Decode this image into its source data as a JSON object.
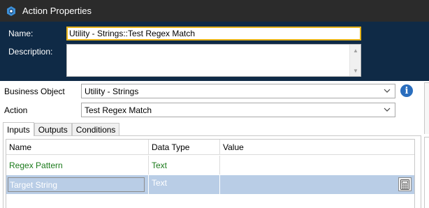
{
  "window": {
    "title": "Action Properties",
    "app_icon": "blueprism-process-icon"
  },
  "header": {
    "name_label": "Name:",
    "name_value": "Utility - Strings::Test Regex Match",
    "description_label": "Description:",
    "description_value": ""
  },
  "form": {
    "business_object_label": "Business Object",
    "business_object_value": "Utility - Strings",
    "action_label": "Action",
    "action_value": "Test Regex Match",
    "info_icon": "info-icon"
  },
  "tabs": [
    {
      "label": "Inputs",
      "active": true
    },
    {
      "label": "Outputs",
      "active": false
    },
    {
      "label": "Conditions",
      "active": false
    }
  ],
  "grid": {
    "columns": [
      "Name",
      "Data Type",
      "Value"
    ],
    "rows": [
      {
        "name": "Regex Pattern",
        "data_type": "Text",
        "value": "",
        "selected": false
      },
      {
        "name": "Target String",
        "data_type": "Text",
        "value": "",
        "selected": true
      }
    ],
    "row_button_icon": "calculator-icon"
  },
  "colors": {
    "titlebar": "#2b2b2b",
    "header_bg": "#0f2a46",
    "focus_border": "#e6b31a",
    "row_text_green": "#1b7a1b",
    "selection_bg": "#b9cde6",
    "info_blue": "#2a6ebe"
  }
}
